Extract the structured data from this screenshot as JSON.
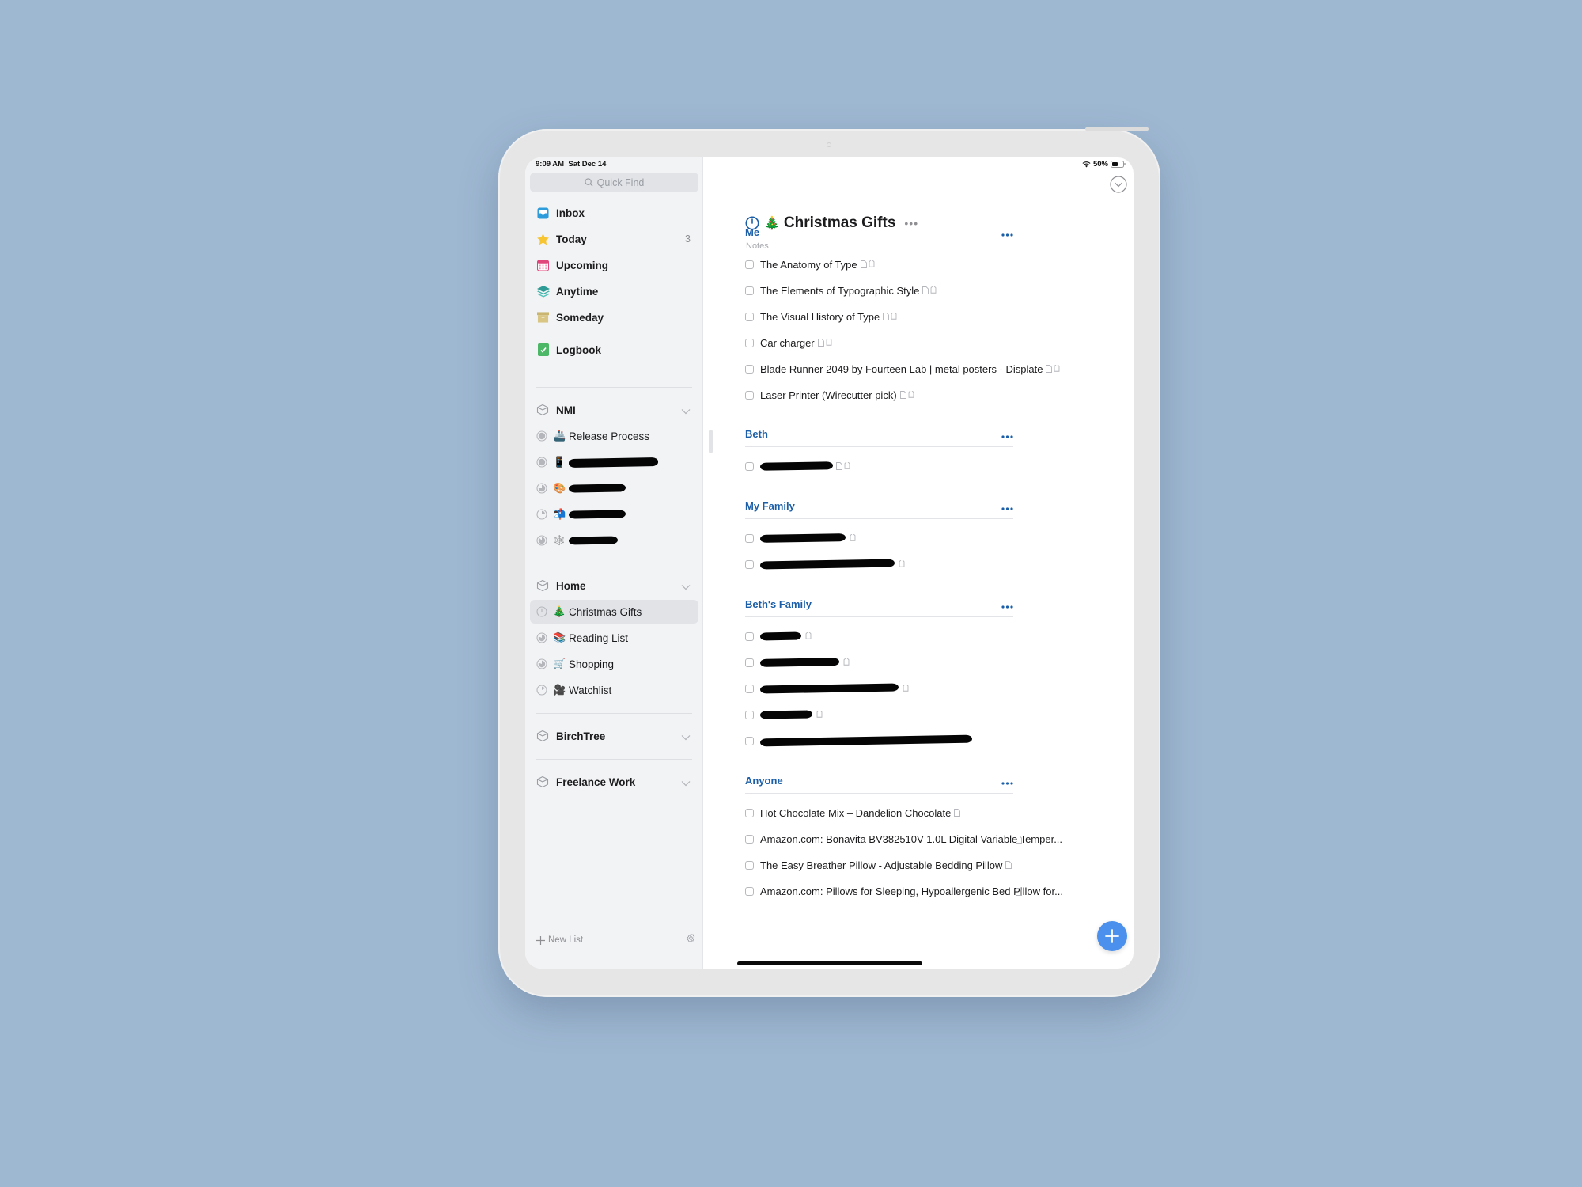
{
  "status_bar": {
    "time": "9:09 AM",
    "date": "Sat Dec 14",
    "battery": "50%"
  },
  "sidebar": {
    "search_placeholder": "Quick Find",
    "nav": [
      {
        "label": "Inbox",
        "icon": "inbox-icon"
      },
      {
        "label": "Today",
        "icon": "star-icon",
        "count": "3"
      },
      {
        "label": "Upcoming",
        "icon": "calendar-icon"
      },
      {
        "label": "Anytime",
        "icon": "layers-icon"
      },
      {
        "label": "Someday",
        "icon": "archive-box-icon"
      },
      {
        "label": "Logbook",
        "icon": "logbook-icon"
      }
    ],
    "areas": [
      {
        "label": "NMI",
        "projects": [
          {
            "emoji": "🚢",
            "label": "Release Process",
            "redacted": false
          },
          {
            "emoji": "📱",
            "label": "",
            "redacted": true
          },
          {
            "emoji": "🎨",
            "label": "",
            "redacted": true
          },
          {
            "emoji": "📬",
            "label": "",
            "redacted": true
          },
          {
            "emoji": "🕸",
            "label": "",
            "redacted": true
          }
        ]
      },
      {
        "label": "Home",
        "projects": [
          {
            "emoji": "🎄",
            "label": "Christmas Gifts",
            "selected": true
          },
          {
            "emoji": "📚",
            "label": "Reading List"
          },
          {
            "emoji": "🛒",
            "label": "Shopping"
          },
          {
            "emoji": "🎥",
            "label": "Watchlist"
          }
        ]
      },
      {
        "label": "BirchTree",
        "projects": []
      },
      {
        "label": "Freelance Work",
        "projects": []
      }
    ],
    "new_list_label": "New List"
  },
  "main": {
    "title_emoji": "🎄",
    "title": "Christmas Gifts",
    "more_label": "•••",
    "notes_placeholder": "Notes",
    "sections": [
      {
        "heading": "Me",
        "items": [
          {
            "title": "The Anatomy of Type",
            "note": true,
            "tag": true
          },
          {
            "title": "The Elements of Typographic Style",
            "note": true,
            "tag": true
          },
          {
            "title": "The Visual History of Type",
            "note": true,
            "tag": true
          },
          {
            "title": "Car charger",
            "note": true,
            "tag": true
          },
          {
            "title": "Blade Runner 2049 by Fourteen Lab | metal posters - Displate",
            "note": true,
            "tag": true
          },
          {
            "title": "Laser Printer (Wirecutter pick)",
            "note": true,
            "tag": true
          }
        ]
      },
      {
        "heading": "Beth",
        "items": [
          {
            "title": "",
            "redacted": true,
            "note": true,
            "tag": true
          }
        ]
      },
      {
        "heading": "My Family",
        "items": [
          {
            "title": "",
            "redacted": true,
            "tag": true
          },
          {
            "title": "",
            "redacted": true,
            "tag": true
          }
        ]
      },
      {
        "heading": "Beth's Family",
        "items": [
          {
            "title": "",
            "redacted": true,
            "tag": true
          },
          {
            "title": "",
            "redacted": true,
            "tag": true
          },
          {
            "title": "",
            "redacted": true,
            "tag": true
          },
          {
            "title": "",
            "redacted": true,
            "tag": true
          },
          {
            "title": "",
            "redacted": true
          }
        ]
      },
      {
        "heading": "Anyone",
        "items": [
          {
            "title": "Hot Chocolate Mix – Dandelion Chocolate",
            "note": true
          },
          {
            "title": "Amazon.com: Bonavita BV382510V 1.0L Digital Variable Temper...",
            "note": true
          },
          {
            "title": "The Easy Breather Pillow - Adjustable Bedding Pillow",
            "note": true
          },
          {
            "title": "Amazon.com: Pillows for Sleeping, Hypoallergenic Bed Pillow for...",
            "note": true
          }
        ]
      }
    ]
  },
  "colors": {
    "accent": "#1c5fa8",
    "fab": "#4a90ec",
    "background": "#9fb8d2",
    "sidebar": "#f2f3f5"
  }
}
